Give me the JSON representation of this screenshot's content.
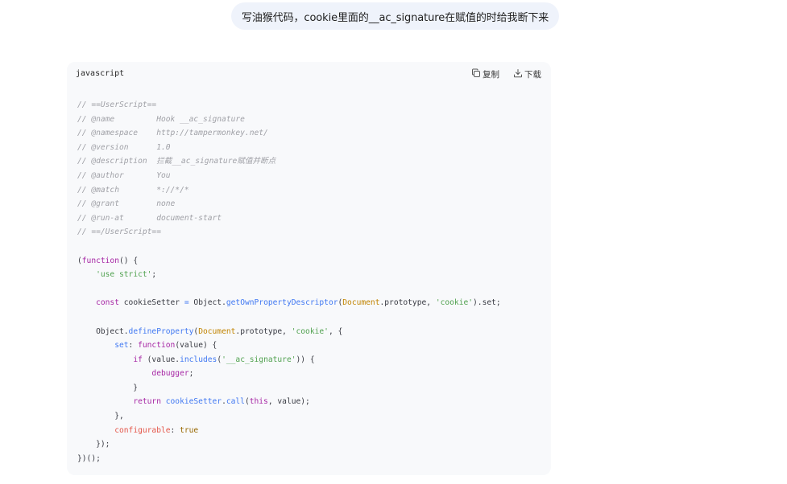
{
  "chat": {
    "user_message": "写油猴代码，cookie里面的__ac_signature在赋值的时给我断下来"
  },
  "code_block": {
    "language": "javascript",
    "copy_label": "复制",
    "download_label": "下载",
    "lines": [
      [
        [
          "c-comment",
          "// ==UserScript=="
        ]
      ],
      [
        [
          "c-comment",
          "// @name         Hook __ac_signature"
        ]
      ],
      [
        [
          "c-comment",
          "// @namespace    http://tampermonkey.net/"
        ]
      ],
      [
        [
          "c-comment",
          "// @version      1.0"
        ]
      ],
      [
        [
          "c-comment",
          "// @description  拦截__ac_signature赋值并断点"
        ]
      ],
      [
        [
          "c-comment",
          "// @author       You"
        ]
      ],
      [
        [
          "c-comment",
          "// @match        *://*/*"
        ]
      ],
      [
        [
          "c-comment",
          "// @grant        none"
        ]
      ],
      [
        [
          "c-comment",
          "// @run-at       document-start"
        ]
      ],
      [
        [
          "c-comment",
          "// ==/UserScript=="
        ]
      ],
      [],
      [
        [
          "c-plain",
          "("
        ],
        [
          "c-purple",
          "function"
        ],
        [
          "c-plain",
          "() {"
        ]
      ],
      [
        [
          "c-plain",
          "    "
        ],
        [
          "c-string",
          "'use strict'"
        ],
        [
          "c-plain",
          ";"
        ]
      ],
      [],
      [
        [
          "c-plain",
          "    "
        ],
        [
          "c-purple",
          "const"
        ],
        [
          "c-plain",
          " cookieSetter "
        ],
        [
          "c-blue",
          "="
        ],
        [
          "c-plain",
          " Object."
        ],
        [
          "c-blue",
          "getOwnPropertyDescriptor"
        ],
        [
          "c-plain",
          "("
        ],
        [
          "c-class",
          "Document"
        ],
        [
          "c-plain",
          ".prototype, "
        ],
        [
          "c-string",
          "'cookie'"
        ],
        [
          "c-plain",
          ").set;"
        ]
      ],
      [],
      [
        [
          "c-plain",
          "    Object."
        ],
        [
          "c-blue",
          "defineProperty"
        ],
        [
          "c-plain",
          "("
        ],
        [
          "c-class",
          "Document"
        ],
        [
          "c-plain",
          ".prototype, "
        ],
        [
          "c-string",
          "'cookie'"
        ],
        [
          "c-plain",
          ", {"
        ]
      ],
      [
        [
          "c-plain",
          "        "
        ],
        [
          "c-blue",
          "set"
        ],
        [
          "c-plain",
          ": "
        ],
        [
          "c-purple",
          "function"
        ],
        [
          "c-plain",
          "(value) {"
        ]
      ],
      [
        [
          "c-plain",
          "            "
        ],
        [
          "c-purple",
          "if"
        ],
        [
          "c-plain",
          " (value."
        ],
        [
          "c-blue",
          "includes"
        ],
        [
          "c-plain",
          "("
        ],
        [
          "c-string",
          "'__ac_signature'"
        ],
        [
          "c-plain",
          ")) {"
        ]
      ],
      [
        [
          "c-plain",
          "                "
        ],
        [
          "c-purple",
          "debugger"
        ],
        [
          "c-plain",
          ";"
        ]
      ],
      [
        [
          "c-plain",
          "            }"
        ]
      ],
      [
        [
          "c-plain",
          "            "
        ],
        [
          "c-purple",
          "return"
        ],
        [
          "c-plain",
          " "
        ],
        [
          "c-blue",
          "cookieSetter"
        ],
        [
          "c-plain",
          "."
        ],
        [
          "c-blue",
          "call"
        ],
        [
          "c-plain",
          "("
        ],
        [
          "c-purple",
          "this"
        ],
        [
          "c-plain",
          ", value);"
        ]
      ],
      [
        [
          "c-plain",
          "        },"
        ]
      ],
      [
        [
          "c-plain",
          "        "
        ],
        [
          "c-red",
          "configurable"
        ],
        [
          "c-plain",
          ": "
        ],
        [
          "c-orange",
          "true"
        ]
      ],
      [
        [
          "c-plain",
          "    });"
        ]
      ],
      [
        [
          "c-plain",
          "})();"
        ]
      ]
    ]
  }
}
